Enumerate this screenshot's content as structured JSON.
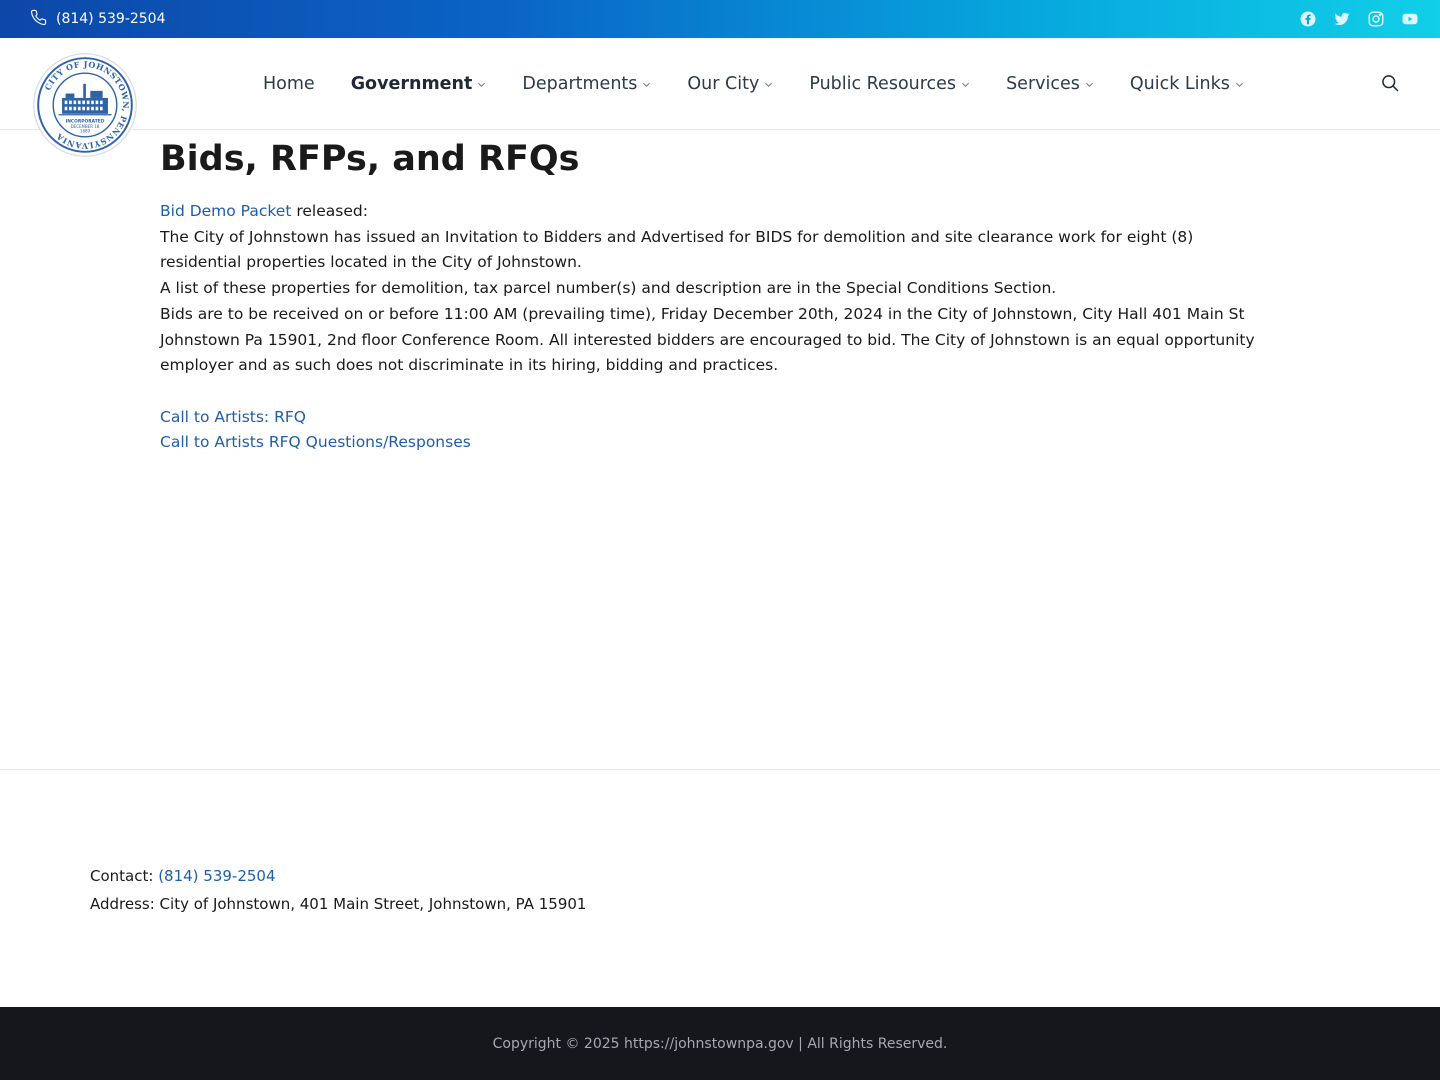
{
  "topbar": {
    "phone": "(814) 539-2504",
    "social_icons": [
      "facebook-icon",
      "twitter-icon",
      "instagram-icon",
      "youtube-icon"
    ]
  },
  "header": {
    "logo": {
      "ring_text": "CITY OF JOHNSTOWN, PENNSYLVANIA",
      "inner_text": [
        "INCORPORATED",
        "DECEMBER 18",
        "1889"
      ]
    },
    "nav": [
      {
        "label": "Home",
        "has_dropdown": false,
        "active": false
      },
      {
        "label": "Government",
        "has_dropdown": true,
        "active": true
      },
      {
        "label": "Departments",
        "has_dropdown": true,
        "active": false
      },
      {
        "label": "Our City",
        "has_dropdown": true,
        "active": false
      },
      {
        "label": "Public Resources",
        "has_dropdown": true,
        "active": false
      },
      {
        "label": "Services",
        "has_dropdown": true,
        "active": false
      },
      {
        "label": "Quick Links",
        "has_dropdown": true,
        "active": false
      }
    ]
  },
  "main": {
    "title": "Bids, RFPs, and RFQs",
    "bid_link": "Bid Demo Packet",
    "bid_suffix": " released:",
    "para1": "The City of Johnstown has issued an Invitation to Bidders and Advertised for BIDS for demolition and site clearance work for eight (8) residential properties located in the City of Johnstown.",
    "para2": "A list of these properties for demolition, tax parcel number(s) and description are in the Special Conditions Section.",
    "para3": "Bids are to be received on or before 11:00 AM (prevailing time), Friday December 20th, 2024 in the City of Johnstown, City Hall 401 Main St Johnstown Pa 15901, 2nd floor Conference Room. All interested bidders are encouraged to bid. The City of Johnstown is an equal opportunity employer and as such does not discriminate in its hiring, bidding and practices.",
    "link1": "Call to Artists: RFQ",
    "link2": "Call to Artists RFQ Questions/Responses"
  },
  "footer": {
    "contact_label": "Contact: ",
    "contact_phone": "(814) 539-2504",
    "address": "Address: City of Johnstown, 401 Main Street, Johnstown, PA 15901",
    "copyright": "Copyright © 2025 https://johnstownpa.gov | All Rights Reserved."
  },
  "colors": {
    "link": "#1f5ea8",
    "topbar_start": "#0d47a8",
    "topbar_end": "#11cfe8",
    "bottom_bar": "#16161d"
  }
}
